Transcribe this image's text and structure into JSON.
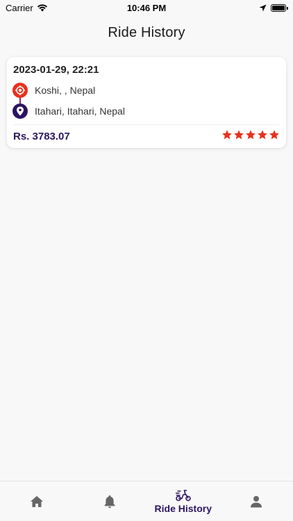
{
  "status_bar": {
    "carrier": "Carrier",
    "time": "10:46 PM"
  },
  "header": {
    "title": "Ride History"
  },
  "rides": [
    {
      "datetime": "2023-01-29, 22:21",
      "from": "Koshi, , Nepal",
      "to": "Itahari, Itahari, Nepal",
      "fare": "Rs. 3783.07",
      "rating": 5,
      "rating_max": 5
    }
  ],
  "bottom_nav": {
    "items": [
      {
        "icon": "home-icon",
        "label": ""
      },
      {
        "icon": "bell-icon",
        "label": ""
      },
      {
        "icon": "scooter-icon",
        "label": "Ride History",
        "active": true
      },
      {
        "icon": "user-icon",
        "label": ""
      }
    ]
  },
  "colors": {
    "accent": "#2b1463",
    "pickup": "#e8301c",
    "star": "#e8301c",
    "inactive_icon": "#666666"
  }
}
